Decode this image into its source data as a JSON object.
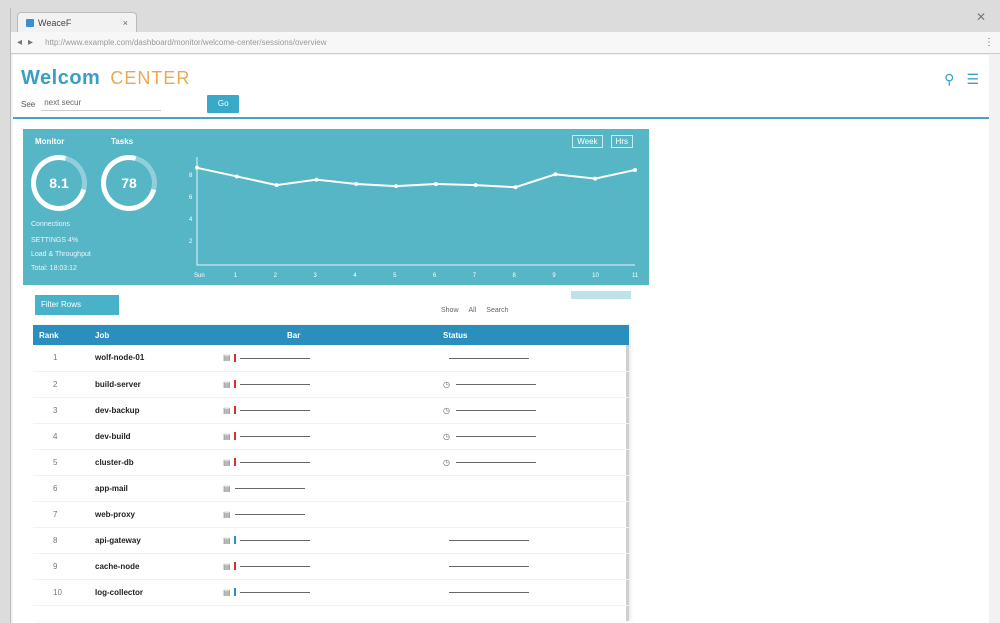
{
  "browser": {
    "tab_title": "WeaceF",
    "tab_close": "×",
    "window_close": "✕",
    "url": "http://www.example.com/dashboard/monitor/welcome-center/sessions/overview",
    "nav_back": "◂",
    "nav_forward": "▸",
    "menu": "⋮"
  },
  "header": {
    "welcome": "Welcom",
    "brand": "CENTER",
    "search_icon": "search-icon",
    "menu_icon": "menu-icon"
  },
  "filter": {
    "label": "See",
    "value": "next secur",
    "placeholder": "Search",
    "button": "Go"
  },
  "panel": {
    "gauge1": {
      "label": "Monitor",
      "value": "8.1"
    },
    "gauge2": {
      "label": "Tasks",
      "value": "78"
    },
    "info_lines": [
      "Connections",
      "SETTINGS   4%",
      "Load & Throughput",
      "Total: 18:03:12"
    ],
    "buttons": [
      "Week",
      "Hrs"
    ],
    "accent": "#56b6c6"
  },
  "chart_data": {
    "type": "line",
    "x": [
      "Sun",
      "1",
      "2",
      "3",
      "4",
      "5",
      "6",
      "7",
      "8",
      "9",
      "10",
      "11"
    ],
    "series": [
      {
        "values": [
          90,
          82,
          74,
          79,
          75,
          73,
          75,
          74,
          72,
          84,
          80,
          88
        ]
      }
    ],
    "ylim": [
      0,
      100
    ],
    "yticks": [
      "8",
      "6",
      "4",
      "2"
    ]
  },
  "list": {
    "tool_button": "Filter   Rows",
    "filter_labels": [
      "Show",
      "All",
      "Search"
    ],
    "columns": [
      "Rank",
      "Job",
      "Bar",
      "Status"
    ],
    "rows": [
      {
        "rank": "1",
        "job": "wolf-node-01",
        "flag": "#d43030",
        "has_status": true,
        "status_icon": ""
      },
      {
        "rank": "2",
        "job": "build-server",
        "flag": "#d43030",
        "has_status": true,
        "status_icon": "◷"
      },
      {
        "rank": "3",
        "job": "dev-backup",
        "flag": "#d43030",
        "has_status": true,
        "status_icon": "◷"
      },
      {
        "rank": "4",
        "job": "dev-build",
        "flag": "#d43030",
        "has_status": true,
        "status_icon": "◷"
      },
      {
        "rank": "5",
        "job": "cluster-db",
        "flag": "#d43030",
        "has_status": true,
        "status_icon": "◷"
      },
      {
        "rank": "6",
        "job": "app-mail",
        "flag": "",
        "has_status": false,
        "status_icon": ""
      },
      {
        "rank": "7",
        "job": "web-proxy",
        "flag": "",
        "has_status": false,
        "status_icon": ""
      },
      {
        "rank": "8",
        "job": "api-gateway",
        "flag": "#2b8fbd",
        "has_status": true,
        "status_icon": ""
      },
      {
        "rank": "9",
        "job": "cache-node",
        "flag": "#d43030",
        "has_status": true,
        "status_icon": ""
      },
      {
        "rank": "10",
        "job": "log-collector",
        "flag": "#2b8fbd",
        "has_status": true,
        "status_icon": ""
      }
    ]
  }
}
